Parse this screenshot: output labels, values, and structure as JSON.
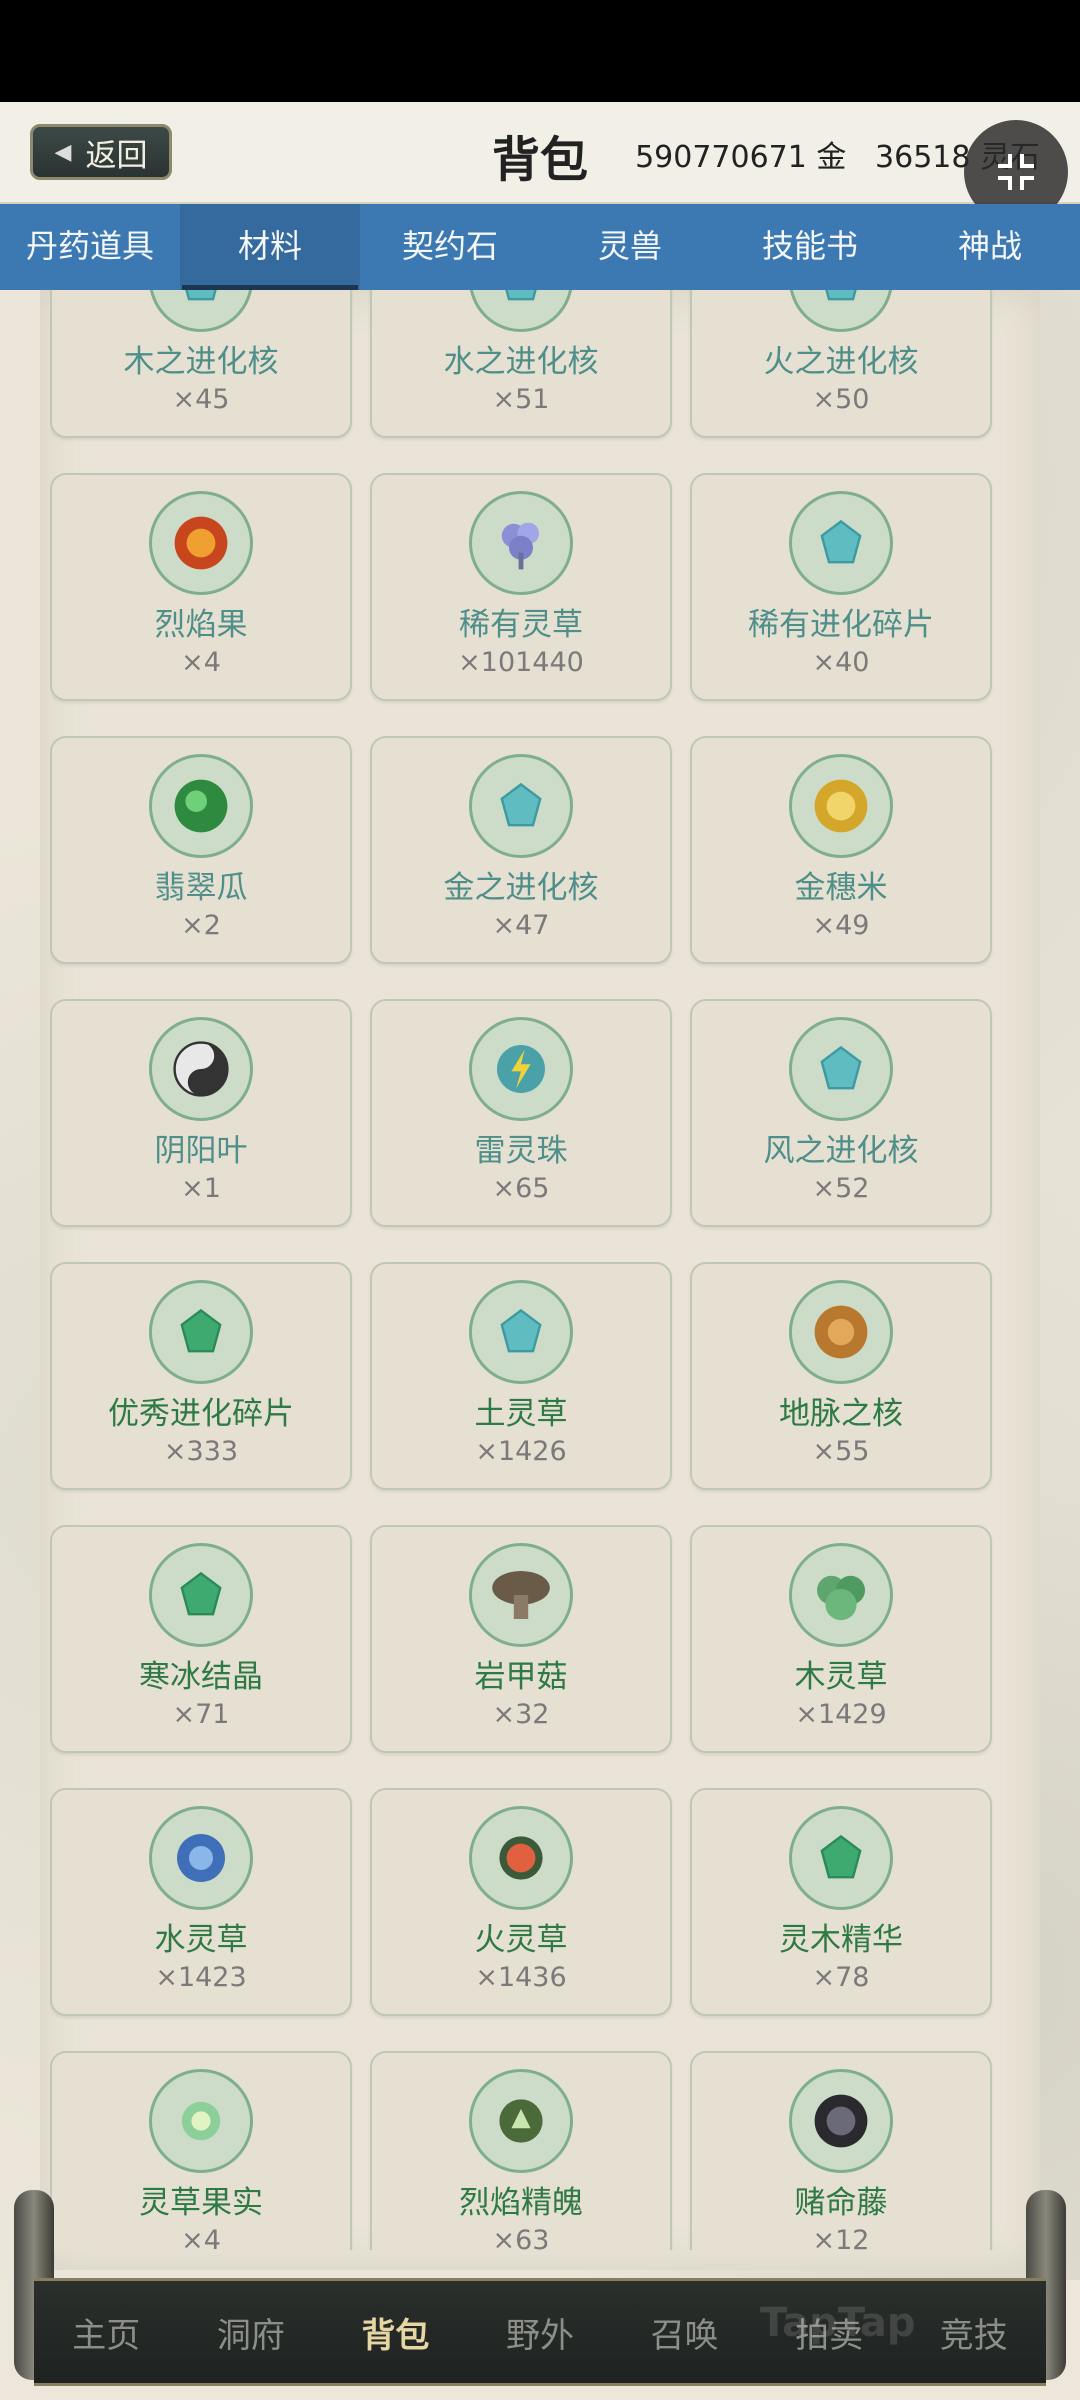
{
  "header": {
    "back_label": "返回",
    "title": "背包",
    "gold_amount": "590770671",
    "gold_unit": "金",
    "spirit_stone_amount": "36518",
    "spirit_stone_unit": "灵石"
  },
  "tabs": [
    {
      "label": "丹药道具",
      "active": false
    },
    {
      "label": "材料",
      "active": true
    },
    {
      "label": "契约石",
      "active": false
    },
    {
      "label": "灵兽",
      "active": false
    },
    {
      "label": "技能书",
      "active": false
    },
    {
      "label": "神战",
      "active": false
    }
  ],
  "items": [
    {
      "name": "木之进化核",
      "count": "×45",
      "icon": "wood-evolution-core-icon"
    },
    {
      "name": "水之进化核",
      "count": "×51",
      "icon": "water-evolution-core-icon"
    },
    {
      "name": "火之进化核",
      "count": "×50",
      "icon": "fire-evolution-core-icon"
    },
    {
      "name": "烈焰果",
      "count": "×4",
      "icon": "flame-fruit-icon"
    },
    {
      "name": "稀有灵草",
      "count": "×101440",
      "icon": "rare-spirit-herb-icon"
    },
    {
      "name": "稀有进化碎片",
      "count": "×40",
      "icon": "rare-evolution-shard-icon"
    },
    {
      "name": "翡翠瓜",
      "count": "×2",
      "icon": "jade-melon-icon"
    },
    {
      "name": "金之进化核",
      "count": "×47",
      "icon": "metal-evolution-core-icon"
    },
    {
      "name": "金穗米",
      "count": "×49",
      "icon": "golden-rice-icon"
    },
    {
      "name": "阴阳叶",
      "count": "×1",
      "icon": "yin-yang-leaf-icon"
    },
    {
      "name": "雷灵珠",
      "count": "×65",
      "icon": "thunder-pearl-icon"
    },
    {
      "name": "风之进化核",
      "count": "×52",
      "icon": "wind-evolution-core-icon"
    },
    {
      "name": "优秀进化碎片",
      "count": "×333",
      "icon": "excellent-evolution-shard-icon"
    },
    {
      "name": "土灵草",
      "count": "×1426",
      "icon": "earth-spirit-herb-icon"
    },
    {
      "name": "地脉之核",
      "count": "×55",
      "icon": "earth-vein-core-icon"
    },
    {
      "name": "寒冰结晶",
      "count": "×71",
      "icon": "ice-crystal-icon"
    },
    {
      "name": "岩甲菇",
      "count": "×32",
      "icon": "rock-mushroom-icon"
    },
    {
      "name": "木灵草",
      "count": "×1429",
      "icon": "wood-spirit-herb-icon"
    },
    {
      "name": "水灵草",
      "count": "×1423",
      "icon": "water-spirit-herb-icon"
    },
    {
      "name": "火灵草",
      "count": "×1436",
      "icon": "fire-spirit-herb-icon"
    },
    {
      "name": "灵木精华",
      "count": "×78",
      "icon": "spirit-wood-essence-icon"
    },
    {
      "name": "灵草果实",
      "count": "×4",
      "icon": "spirit-herb-fruit-icon"
    },
    {
      "name": "烈焰精魄",
      "count": "×63",
      "icon": "flame-soul-icon"
    },
    {
      "name": "赌命藤",
      "count": "×12",
      "icon": "gamble-vine-icon"
    }
  ],
  "bottom_nav": [
    {
      "label": "主页",
      "active": false
    },
    {
      "label": "洞府",
      "active": false
    },
    {
      "label": "背包",
      "active": true
    },
    {
      "label": "野外",
      "active": false
    },
    {
      "label": "召唤",
      "active": false
    },
    {
      "label": "拍卖",
      "active": false
    },
    {
      "label": "竞技",
      "active": false
    }
  ],
  "watermark": "TapTap"
}
